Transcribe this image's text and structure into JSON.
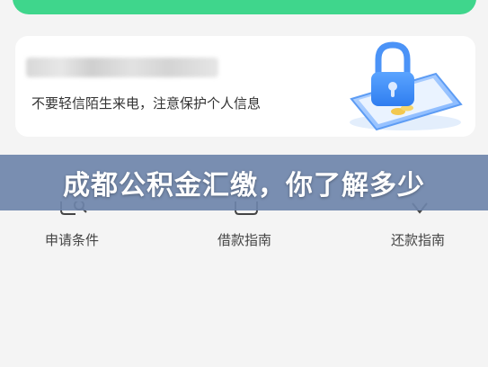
{
  "notice": {
    "caption": "不要轻信陌生来电，注意保护个人信息"
  },
  "banner": {
    "title": "成都公积金汇缴，你了解多少"
  },
  "nav": {
    "items": [
      {
        "label": "申请条件"
      },
      {
        "label": "借款指南"
      },
      {
        "label": "还款指南"
      }
    ]
  },
  "colors": {
    "accent_green": "#3fd68c",
    "banner_overlay": "#6e84aa",
    "illustration_blue": "#3a8bf5"
  }
}
